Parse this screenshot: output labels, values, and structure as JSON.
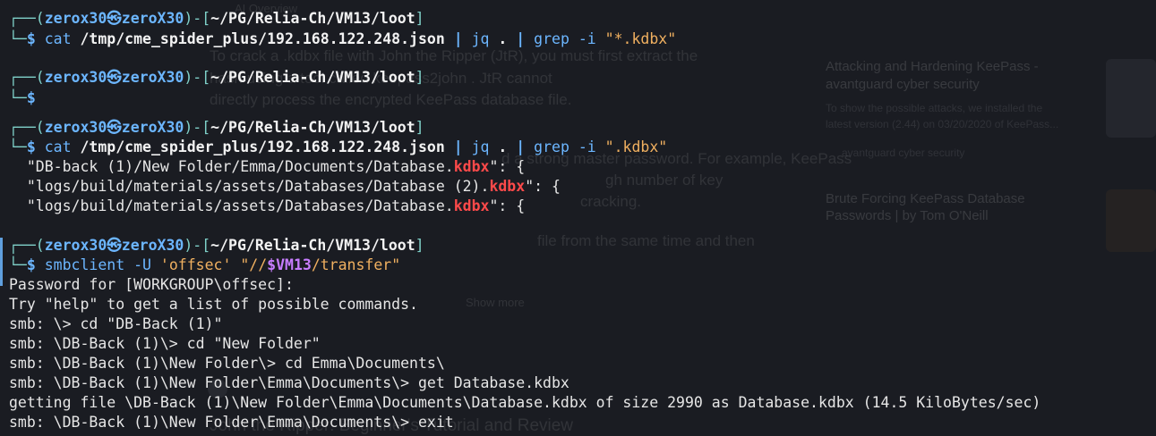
{
  "background_page": {
    "heading": "AI Overview",
    "para1_l1": "To crack a .kdbx file with John the Ripper (JtR), you must first extract the",
    "para1_l2": "hash using a tool called keepass2john . JtR cannot",
    "para1_l3": "directly process the encrypted KeePass database file.",
    "para2_l1": "d a strong master password. For example, KeePass",
    "para2_l2": "gh number of key",
    "para2_l3": "cracking.",
    "para3_l1": "file from the same time and then",
    "show_more": "Show more",
    "bottom_title": "John the Ripper: Beginner's Tutorial and Review",
    "side1_title_l1": "Attacking and Hardening KeePass -",
    "side1_title_l2": "avantguard cyber security",
    "side1_text_l1": "To show the possible attacks, we installed the",
    "side1_text_l2": "latest version (2.44) on 03/20/2020 of KeePass...",
    "side1_source": "avantguard cyber security",
    "side2_title_l1": "Brute Forcing KeePass Database",
    "side2_title_l2": "Passwords | by Tom O'Neill"
  },
  "terminal": {
    "prompt": {
      "open": "┌──(",
      "user": "zerox30",
      "skull": "㉿",
      "host": "zeroX30",
      "mid": ")-[",
      "path": "~/PG/Relia-Ch/VM13/loot",
      "close": "]",
      "cont": "└─",
      "dollar": "$ "
    },
    "block1": {
      "cmd": "cat",
      "file": "/tmp/cme_spider_plus/192.168.122.248.json",
      "pipe1": "|",
      "jq": "jq",
      "dot": ".",
      "pipe2": "|",
      "grep": "grep",
      "flag": "-i",
      "pattern": "\"*.kdbx\""
    },
    "block3": {
      "cmd": "cat",
      "file": "/tmp/cme_spider_plus/192.168.122.248.json",
      "pipe1": "|",
      "jq": "jq",
      "dot": ".",
      "pipe2": "|",
      "grep": "grep",
      "flag": "-i",
      "pattern": "\".kdbx\"",
      "results": [
        {
          "pre": "  \"DB-back (1)/New Folder/Emma/Documents/Database.",
          "match": "kdbx",
          "post": "\": {"
        },
        {
          "pre": "  \"logs/build/materials/assets/Databases/Database (2).",
          "match": "kdbx",
          "post": "\": {"
        },
        {
          "pre": "  \"logs/build/materials/assets/Databases/Database.",
          "match": "kdbx",
          "post": "\": {"
        }
      ]
    },
    "block4": {
      "cmd": "smbclient",
      "flag": "-U",
      "user_arg": "'offsec'",
      "share_pre": "\"//",
      "share_var": "$VM13",
      "share_post": "/transfer\"",
      "output": [
        "Password for [WORKGROUP\\offsec]:",
        "Try \"help\" to get a list of possible commands.",
        "smb: \\> cd \"DB-Back (1)\"",
        "smb: \\DB-Back (1)\\> cd \"New Folder\"",
        "smb: \\DB-Back (1)\\New Folder\\> cd Emma\\Documents\\",
        "smb: \\DB-Back (1)\\New Folder\\Emma\\Documents\\> get Database.kdbx",
        "getting file \\DB-Back (1)\\New Folder\\Emma\\Documents\\Database.kdbx of size 2990 as Database.kdbx (14.5 KiloBytes/sec)",
        "smb: \\DB-Back (1)\\New Folder\\Emma\\Documents\\> exit"
      ]
    }
  },
  "colors": {
    "background": "#1a1c22",
    "prompt_blue": "#6cb6ff",
    "frame_teal": "#7fd1c9",
    "string_orange": "#f0b060",
    "match_red": "#ff4a4a",
    "variable_purple": "#c77dff"
  }
}
